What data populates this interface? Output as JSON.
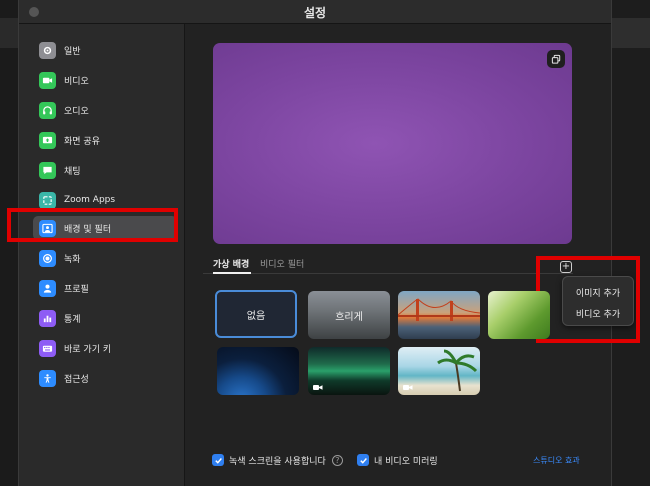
{
  "window": {
    "title": "설정"
  },
  "sidebar": {
    "items": [
      {
        "label": "일반",
        "icon": "gear-icon",
        "color": "#8e8e93"
      },
      {
        "label": "비디오",
        "icon": "video-camera-icon",
        "color": "#34c759"
      },
      {
        "label": "오디오",
        "icon": "headphones-icon",
        "color": "#34c759"
      },
      {
        "label": "화면 공유",
        "icon": "share-screen-icon",
        "color": "#34c759"
      },
      {
        "label": "채팅",
        "icon": "chat-bubble-icon",
        "color": "#34c759"
      },
      {
        "label": "Zoom Apps",
        "icon": "apps-icon",
        "color": "#3ab6a8"
      },
      {
        "label": "배경 및 필터",
        "icon": "background-portrait-icon",
        "color": "#2d8cff",
        "active": true
      },
      {
        "label": "녹화",
        "icon": "record-icon",
        "color": "#2d8cff"
      },
      {
        "label": "프로필",
        "icon": "person-icon",
        "color": "#2d8cff"
      },
      {
        "label": "통계",
        "icon": "bar-chart-icon",
        "color": "#8e5cf5"
      },
      {
        "label": "바로 가기 키",
        "icon": "keyboard-icon",
        "color": "#8e5cf5"
      },
      {
        "label": "접근성",
        "icon": "accessibility-icon",
        "color": "#2d8cff"
      }
    ]
  },
  "main": {
    "tabs": [
      {
        "label": "가상 배경",
        "active": true
      },
      {
        "label": "비디오 필터",
        "active": false
      }
    ],
    "add_menu": {
      "items": [
        "이미지 추가",
        "비디오 추가"
      ]
    },
    "backgrounds": [
      {
        "label": "없음",
        "kind": "none",
        "selected": true
      },
      {
        "label": "흐리게",
        "kind": "blur"
      },
      {
        "label": "",
        "kind": "golden-gate-bridge"
      },
      {
        "label": "",
        "kind": "grass"
      },
      {
        "label": "",
        "kind": "earth-from-space"
      },
      {
        "label": "",
        "kind": "aurora",
        "video": true
      },
      {
        "label": "",
        "kind": "beach",
        "video": true
      }
    ],
    "footer": {
      "green_screen_label": "녹색 스크린을 사용합니다",
      "mirror_label": "내 비디오 미러링",
      "studio_effects": "스튜디오 효과"
    }
  },
  "colors": {
    "accent": "#2f7ff0",
    "highlight": "#e00000",
    "preview": "#8f54b3"
  }
}
